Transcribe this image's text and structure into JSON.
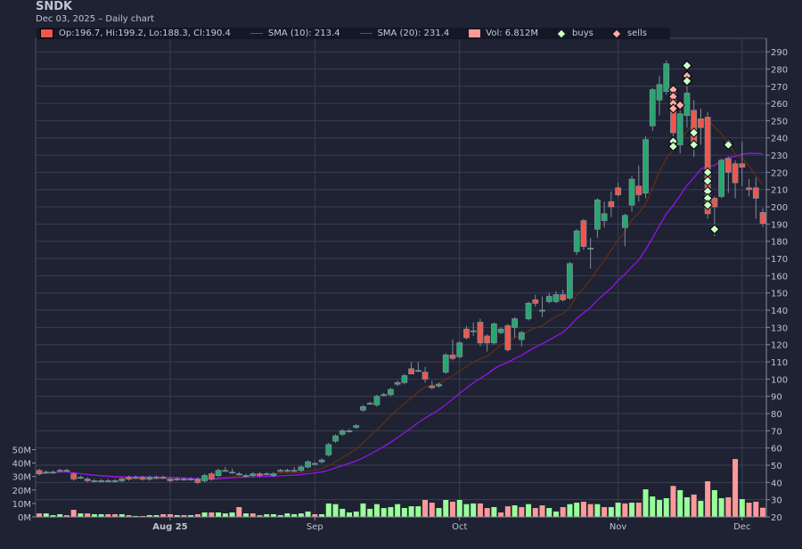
{
  "header": {
    "title": "SNDK",
    "subtitle": "Dec 03, 2025 – Daily chart"
  },
  "legend": {
    "ohlc": "Op:196.7, Hi:199.2, Lo:188.3, Cl:190.4",
    "sma10": "SMA (10): 213.4",
    "sma20": "SMA (20): 231.4",
    "volume": "Vol: 6.812M",
    "buys": "buys",
    "sells": "sells"
  },
  "colors": {
    "background": "#1e2233",
    "grid": "#3a3f52",
    "up": "#26a86e",
    "down": "#f2564a",
    "candle_border": "#7f8c9a",
    "vol_up": "#99ff99",
    "vol_down": "#ff9999",
    "sma10": "#5c3018",
    "sma20": "#9414e6",
    "buy": "#ccffcc",
    "sell": "#ffaaaa"
  },
  "chart_data": {
    "type": "candlestick",
    "title": "SNDK",
    "price_axis": {
      "min": 20,
      "max": 290,
      "step": 10,
      "position": "right"
    },
    "volume_axis": {
      "min": 0,
      "max": 50,
      "step": 10,
      "unit": "M",
      "labels": [
        "0M",
        "10M",
        "20M",
        "30M",
        "40M",
        "50M"
      ],
      "position": "left"
    },
    "x_ticks": [
      {
        "label": "Aug 25",
        "index": 19,
        "bold": true
      },
      {
        "label": "Sep",
        "index": 40
      },
      {
        "label": "Oct",
        "index": 61
      },
      {
        "label": "Nov",
        "index": 84
      },
      {
        "label": "Dec",
        "index": 102
      }
    ],
    "candles_ohlc": [
      [
        47,
        48,
        44,
        45
      ],
      [
        46,
        47,
        45,
        46
      ],
      [
        46,
        47,
        45,
        46
      ],
      [
        47,
        48,
        46,
        47
      ],
      [
        47,
        48,
        46,
        47
      ],
      [
        45,
        46,
        41,
        42
      ],
      [
        43,
        44,
        42,
        43
      ],
      [
        42,
        43,
        40,
        41
      ],
      [
        41,
        42,
        40,
        41
      ],
      [
        41,
        42,
        40,
        41
      ],
      [
        41,
        42,
        40,
        41
      ],
      [
        41,
        42,
        40,
        41
      ],
      [
        41,
        43,
        40,
        42
      ],
      [
        43,
        44,
        41,
        42
      ],
      [
        43,
        44,
        42,
        43
      ],
      [
        43,
        44,
        41,
        42
      ],
      [
        42,
        44,
        41,
        43
      ],
      [
        43,
        44,
        42,
        43
      ],
      [
        43,
        44,
        42,
        43
      ],
      [
        42,
        43,
        40,
        41
      ],
      [
        42,
        43,
        41,
        42
      ],
      [
        42,
        43,
        41,
        42
      ],
      [
        42,
        43,
        41,
        42
      ],
      [
        42,
        43,
        39,
        40
      ],
      [
        41,
        45,
        40,
        44
      ],
      [
        45,
        46,
        41,
        42
      ],
      [
        44,
        48,
        43,
        47
      ],
      [
        47,
        49,
        46,
        47
      ],
      [
        46,
        48,
        45,
        46
      ],
      [
        45,
        46,
        44,
        45
      ],
      [
        44,
        45,
        43,
        44
      ],
      [
        44,
        46,
        43,
        45
      ],
      [
        45,
        46,
        43,
        44
      ],
      [
        45,
        46,
        44,
        45
      ],
      [
        44,
        46,
        43,
        45
      ],
      [
        47,
        48,
        46,
        47
      ],
      [
        47,
        48,
        46,
        47
      ],
      [
        47,
        49,
        46,
        47
      ],
      [
        47,
        50,
        46,
        49
      ],
      [
        49,
        53,
        48,
        52
      ],
      [
        51,
        52,
        50,
        51
      ],
      [
        52,
        54,
        51,
        53
      ],
      [
        56,
        63,
        55,
        62
      ],
      [
        64,
        68,
        63,
        67
      ],
      [
        68,
        71,
        67,
        70
      ],
      [
        70,
        71,
        69,
        70
      ],
      [
        72,
        74,
        71,
        73
      ],
      [
        82,
        85,
        81,
        84
      ],
      [
        86,
        87,
        85,
        86
      ],
      [
        85,
        91,
        84,
        90
      ],
      [
        91,
        92,
        90,
        91
      ],
      [
        91,
        95,
        90,
        94
      ],
      [
        97,
        99,
        96,
        98
      ],
      [
        98,
        103,
        97,
        102
      ],
      [
        106,
        110,
        103,
        103
      ],
      [
        105,
        110,
        104,
        105
      ],
      [
        104,
        107,
        98,
        100
      ],
      [
        96,
        99,
        94,
        95
      ],
      [
        96,
        98,
        95,
        97
      ],
      [
        104,
        115,
        103,
        114
      ],
      [
        114,
        123,
        111,
        112
      ],
      [
        113,
        122,
        112,
        121
      ],
      [
        129,
        131,
        123,
        124
      ],
      [
        128,
        133,
        125,
        128
      ],
      [
        133,
        135,
        119,
        121
      ],
      [
        125,
        126,
        116,
        121
      ],
      [
        121,
        133,
        120,
        132
      ],
      [
        127,
        130,
        126,
        129
      ],
      [
        131,
        132,
        116,
        117
      ],
      [
        130,
        136,
        124,
        135
      ],
      [
        123,
        128,
        119,
        127
      ],
      [
        135,
        145,
        134,
        144
      ],
      [
        146,
        149,
        142,
        144
      ],
      [
        140,
        148,
        136,
        140
      ],
      [
        145,
        150,
        144,
        148
      ],
      [
        145,
        151,
        144,
        149
      ],
      [
        149,
        152,
        145,
        146
      ],
      [
        147,
        168,
        146,
        167
      ],
      [
        174,
        187,
        172,
        186
      ],
      [
        192,
        193,
        175,
        177
      ],
      [
        176,
        182,
        164,
        176
      ],
      [
        187,
        205,
        182,
        204
      ],
      [
        192,
        203,
        188,
        196
      ],
      [
        203,
        209,
        194,
        200
      ],
      [
        211,
        214,
        206,
        207
      ],
      [
        188,
        196,
        177,
        195
      ],
      [
        201,
        218,
        197,
        216
      ],
      [
        212,
        224,
        203,
        207
      ],
      [
        208,
        241,
        205,
        239
      ],
      [
        247,
        269,
        244,
        268
      ],
      [
        262,
        276,
        253,
        271
      ],
      [
        267,
        285,
        265,
        283
      ],
      [
        268,
        270,
        232,
        243
      ],
      [
        236,
        259,
        231,
        254
      ],
      [
        253,
        271,
        246,
        266
      ],
      [
        256,
        262,
        229,
        237
      ],
      [
        251,
        257,
        236,
        246
      ],
      [
        252,
        255,
        193,
        196
      ],
      [
        205,
        206,
        183,
        200
      ],
      [
        206,
        228,
        205,
        227
      ],
      [
        228,
        229,
        208,
        220
      ],
      [
        225,
        227,
        205,
        214
      ],
      [
        225,
        238,
        212,
        223
      ],
      [
        211,
        216,
        206,
        210
      ],
      [
        211,
        217,
        193,
        205
      ],
      [
        196.7,
        199.2,
        188.3,
        190.4
      ]
    ],
    "volume_millions": [
      2.6,
      2.6,
      1.3,
      2,
      1.3,
      5.3,
      2.6,
      2.6,
      2,
      2,
      2,
      2,
      2,
      1.3,
      0.7,
      0.7,
      1.3,
      1.3,
      2,
      2,
      1.3,
      1.3,
      1.3,
      2,
      3.3,
      3.3,
      3.3,
      2.6,
      3.3,
      7.3,
      2.6,
      2.6,
      1.3,
      2,
      2,
      1.3,
      2.6,
      2,
      2.6,
      4,
      2,
      2,
      10,
      9.5,
      6,
      3.3,
      4,
      10,
      6,
      9.5,
      6.6,
      7.3,
      9.5,
      6.6,
      7.9,
      7.9,
      12.6,
      10.6,
      6.6,
      12.6,
      11.3,
      12.6,
      9.5,
      10,
      10,
      6.6,
      7.3,
      3.3,
      7.9,
      8.6,
      7.3,
      9.5,
      6.6,
      8.6,
      6.6,
      4,
      7.3,
      9.5,
      10.6,
      11.3,
      9.5,
      9.5,
      7.3,
      7.3,
      10.6,
      10,
      10.6,
      10.6,
      20.5,
      15.2,
      12.6,
      13.9,
      23,
      19.9,
      14.6,
      16.6,
      11.9,
      26.5,
      19.9,
      13.9,
      14.6,
      43,
      13.2,
      10.6,
      11.3,
      6.812
    ],
    "volume_up": [
      0,
      1,
      1,
      1,
      0,
      0,
      1,
      0,
      1,
      1,
      0,
      0,
      1,
      0,
      1,
      0,
      1,
      1,
      0,
      0,
      1,
      0,
      1,
      0,
      1,
      0,
      1,
      1,
      1,
      0,
      1,
      0,
      0,
      1,
      1,
      1,
      1,
      1,
      1,
      1,
      0,
      1,
      1,
      1,
      1,
      1,
      1,
      1,
      1,
      1,
      1,
      1,
      1,
      1,
      1,
      1,
      0,
      0,
      1,
      1,
      0,
      1,
      1,
      1,
      0,
      0,
      1,
      0,
      0,
      1,
      0,
      1,
      0,
      0,
      1,
      1,
      0,
      1,
      1,
      0,
      0,
      1,
      0,
      1,
      1,
      0,
      1,
      0,
      1,
      1,
      1,
      1,
      0,
      1,
      1,
      0,
      1,
      0,
      1,
      1,
      0,
      0,
      1,
      0,
      0,
      0
    ],
    "buys": [
      [
        94,
        282
      ],
      [
        92,
        238
      ],
      [
        92,
        235
      ],
      [
        94,
        273
      ],
      [
        95,
        243
      ],
      [
        95,
        236
      ],
      [
        97,
        220
      ],
      [
        97,
        215
      ],
      [
        97,
        209
      ],
      [
        97,
        205
      ],
      [
        97,
        201
      ],
      [
        98,
        187
      ],
      [
        100,
        237
      ],
      [
        100,
        236
      ]
    ],
    "sells": [
      [
        92,
        268
      ],
      [
        92,
        264
      ],
      [
        92,
        260
      ],
      [
        92,
        257
      ],
      [
        93,
        259
      ],
      [
        94,
        276
      ]
    ],
    "sma_periods": [
      10,
      20
    ]
  }
}
